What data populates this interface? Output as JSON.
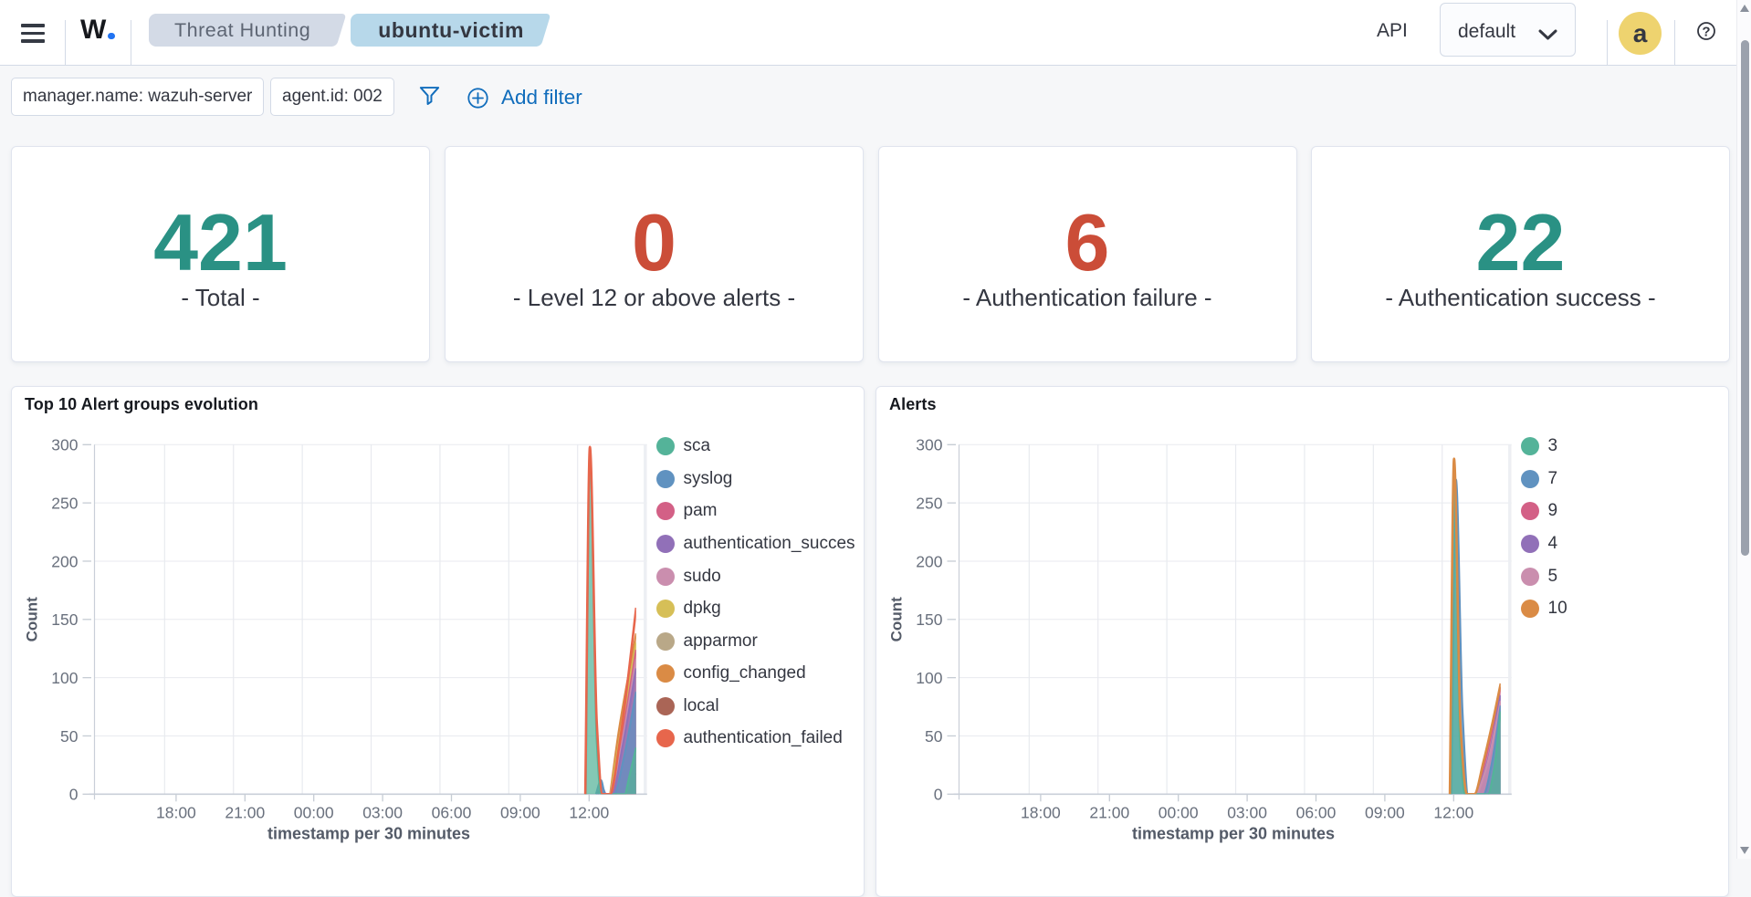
{
  "header": {
    "logo": {
      "text": "W",
      "dot": "."
    },
    "breadcrumbs": [
      {
        "label": "Threat Hunting",
        "active": false
      },
      {
        "label": "ubuntu-victim",
        "active": true
      }
    ],
    "api_label": "API",
    "api_selector": {
      "value": "default"
    },
    "avatar_initial": "a"
  },
  "filter_bar": {
    "pills": [
      "manager.name: wazuh-server",
      "agent.id: 002"
    ],
    "add_filter_label": "Add filter"
  },
  "icons": {
    "menu-icon": "≡",
    "chevron-down-icon": "⌄",
    "help-icon": "?",
    "filter-funnel-icon": "funnel",
    "plus-in-circle-icon": "⊕",
    "scrollbar-up-icon": "▲",
    "scrollbar-down-icon": "▼"
  },
  "metric_cards": [
    {
      "value": "421",
      "label": "- Total -",
      "color": "#2a9184"
    },
    {
      "value": "0",
      "label": "- Level 12 or above alerts -",
      "color": "#cb4d38"
    },
    {
      "value": "6",
      "label": "- Authentication failure -",
      "color": "#cb4d38"
    },
    {
      "value": "22",
      "label": "- Authentication success -",
      "color": "#2a9184"
    }
  ],
  "chart_data": [
    {
      "type": "area",
      "title": "Top 10 Alert groups evolution",
      "xlabel": "timestamp per 30 minutes",
      "ylabel": "Count",
      "ylim": [
        0,
        300
      ],
      "y_ticks": [
        0,
        50,
        100,
        150,
        200,
        250,
        300
      ],
      "x_tick_labels": [
        "18:00",
        "21:00",
        "00:00",
        "03:00",
        "06:00",
        "09:00",
        "12:00"
      ],
      "grid": true,
      "legend_position": "right",
      "series": [
        {
          "name": "sca",
          "color": "#54B399",
          "style": "area",
          "z": 9,
          "points": [
            [
              "11:51",
              0
            ],
            [
              "12:02",
              295
            ],
            [
              "12:20",
              46
            ],
            [
              "12:31",
              0
            ],
            [
              "13:33",
              0
            ],
            [
              "13:45",
              15
            ],
            [
              "14:03",
              40
            ]
          ]
        },
        {
          "name": "syslog",
          "color": "#6092C0",
          "style": "area",
          "z": 8,
          "points": [
            [
              "12:18",
              0
            ],
            [
              "12:31",
              12
            ],
            [
              "12:42",
              0
            ],
            [
              "13:05",
              0
            ],
            [
              "13:30",
              30
            ],
            [
              "14:03",
              88
            ]
          ]
        },
        {
          "name": "pam",
          "color": "#D36086",
          "style": "area",
          "z": 5,
          "points": [
            [
              "12:57",
              0
            ],
            [
              "13:24",
              45
            ],
            [
              "14:03",
              124
            ]
          ]
        },
        {
          "name": "authentication_succes",
          "color": "#9170B8",
          "style": "area",
          "z": 7,
          "points": [
            [
              "12:22",
              0
            ],
            [
              "12:34",
              6
            ],
            [
              "12:44",
              0
            ],
            [
              "13:00",
              0
            ],
            [
              "13:27",
              40
            ],
            [
              "14:03",
              108
            ]
          ]
        },
        {
          "name": "sudo",
          "color": "#CA8EAE",
          "style": "area",
          "z": 6,
          "points": [
            [
              "12:58",
              0
            ],
            [
              "13:25",
              42
            ],
            [
              "14:03",
              116
            ]
          ]
        },
        {
          "name": "dpkg",
          "color": "#D6BF57",
          "style": "area",
          "z": 4,
          "points": [
            [
              "12:56",
              0
            ],
            [
              "13:21",
              50
            ],
            [
              "14:03",
              130
            ]
          ]
        },
        {
          "name": "apparmor",
          "color": "#B9A888",
          "style": "area",
          "z": 1,
          "points": [
            [
              "13:06",
              0
            ],
            [
              "13:30",
              12
            ],
            [
              "14:03",
              26
            ]
          ]
        },
        {
          "name": "config_changed",
          "color": "#DA8B45",
          "style": "area",
          "z": 3,
          "points": [
            [
              "12:55",
              0
            ],
            [
              "13:18",
              55
            ],
            [
              "14:03",
              138
            ]
          ]
        },
        {
          "name": "local",
          "color": "#AA6556",
          "style": "area",
          "z": 2,
          "points": [
            [
              "13:09",
              0
            ],
            [
              "13:36",
              8
            ],
            [
              "14:03",
              18
            ]
          ]
        },
        {
          "name": "authentication_failed",
          "color": "#E7664C",
          "style": "line",
          "z": 10,
          "points": [
            [
              "11:50",
              0
            ],
            [
              "12:02",
              298
            ],
            [
              "12:20",
              62
            ],
            [
              "12:35",
              0
            ],
            [
              "12:55",
              0
            ],
            [
              "13:18",
              40
            ],
            [
              "13:42",
              100
            ],
            [
              "14:03",
              160
            ]
          ]
        }
      ]
    },
    {
      "type": "area",
      "title": "Alerts",
      "xlabel": "timestamp per 30 minutes",
      "ylabel": "Count",
      "ylim": [
        0,
        300
      ],
      "y_ticks": [
        0,
        50,
        100,
        150,
        200,
        250,
        300
      ],
      "x_tick_labels": [
        "18:00",
        "21:00",
        "00:00",
        "03:00",
        "06:00",
        "09:00",
        "12:00"
      ],
      "grid": true,
      "legend_position": "right",
      "series": [
        {
          "name": "3",
          "color": "#54B399",
          "style": "area",
          "z": 5,
          "points": [
            [
              "11:51",
              0
            ],
            [
              "12:01",
              285
            ],
            [
              "12:17",
              42
            ],
            [
              "12:30",
              0
            ],
            [
              "13:30",
              0
            ],
            [
              "13:45",
              20
            ],
            [
              "14:03",
              71
            ]
          ]
        },
        {
          "name": "7",
          "color": "#6092C0",
          "style": "area",
          "z": 4,
          "points": [
            [
              "11:54",
              0
            ],
            [
              "12:06",
              270
            ],
            [
              "12:23",
              72
            ],
            [
              "12:38",
              0
            ],
            [
              "13:18",
              0
            ],
            [
              "13:39",
              25
            ],
            [
              "14:03",
              76
            ]
          ]
        },
        {
          "name": "9",
          "color": "#D36086",
          "style": "area",
          "z": 1,
          "points": [
            [
              "13:00",
              0
            ],
            [
              "13:27",
              35
            ],
            [
              "14:03",
              92
            ]
          ]
        },
        {
          "name": "4",
          "color": "#9170B8",
          "style": "area",
          "z": 2,
          "points": [
            [
              "13:01",
              0
            ],
            [
              "13:30",
              30
            ],
            [
              "14:03",
              85
            ]
          ]
        },
        {
          "name": "5",
          "color": "#CA8EAE",
          "style": "area",
          "z": 3,
          "points": [
            [
              "13:03",
              0
            ],
            [
              "13:30",
              28
            ],
            [
              "14:03",
              80
            ]
          ]
        },
        {
          "name": "10",
          "color": "#DA8B45",
          "style": "line",
          "z": 6,
          "points": [
            [
              "11:50",
              0
            ],
            [
              "12:01",
              288
            ],
            [
              "12:18",
              58
            ],
            [
              "12:35",
              0
            ],
            [
              "12:54",
              0
            ],
            [
              "13:18",
              28
            ],
            [
              "13:42",
              62
            ],
            [
              "14:03",
              95
            ]
          ]
        }
      ]
    }
  ]
}
